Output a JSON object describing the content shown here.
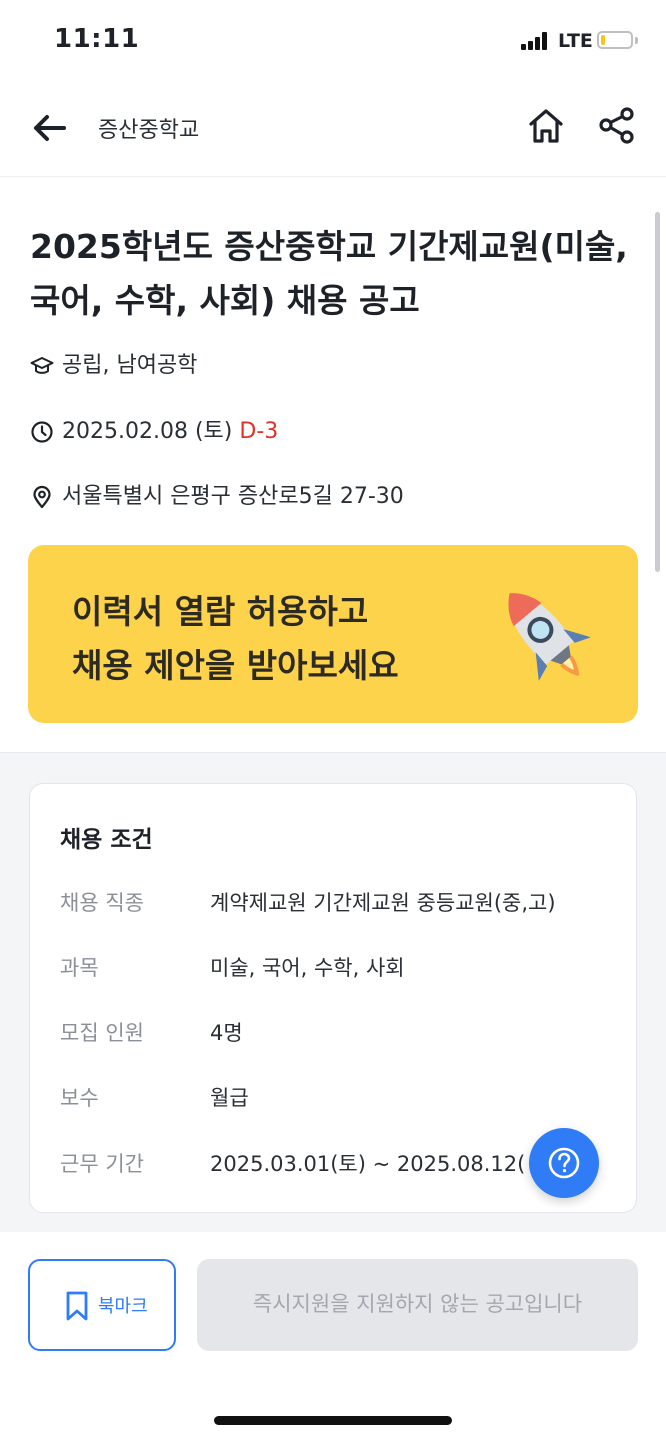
{
  "status_bar": {
    "time": "11:11",
    "network": "LTE",
    "battery_level": 0.15
  },
  "header": {
    "title": "증산중학교",
    "icons": [
      "back-arrow-icon",
      "home-icon",
      "share-icon"
    ]
  },
  "job": {
    "title": "2025학년도 증산중학교 기간제교원(미술, 국어, 수학, 사회) 채용 공고",
    "school_type": "공립, 남여공학",
    "deadline_date": "2025.02.08 (토)",
    "d_day": "D-3",
    "address": "서울특별시 은평구 증산로5길 27-30"
  },
  "banner": {
    "line1": "이력서 열람 허용하고",
    "line2": "채용 제안을 받아보세요",
    "background": "#fdd34c"
  },
  "conditions": {
    "title": "채용 조건",
    "rows": [
      {
        "label": "채용 직종",
        "value": "계약제교원 기간제교원  중등교원(중,고)"
      },
      {
        "label": "과목",
        "value": "미술, 국어, 수학, 사회"
      },
      {
        "label": "모집 인원",
        "value": "4명"
      },
      {
        "label": "보수",
        "value": "월급"
      },
      {
        "label": "근무 기간",
        "value": "2025.03.01(토) ~ 2025.08.12("
      }
    ]
  },
  "bottom": {
    "bookmark_label": "북마크",
    "apply_label": "즉시지원을 지원하지 않는 공고입니다"
  },
  "colors": {
    "accent": "#2f7cf6",
    "dday": "#e0322a",
    "banner": "#fdd34c"
  }
}
